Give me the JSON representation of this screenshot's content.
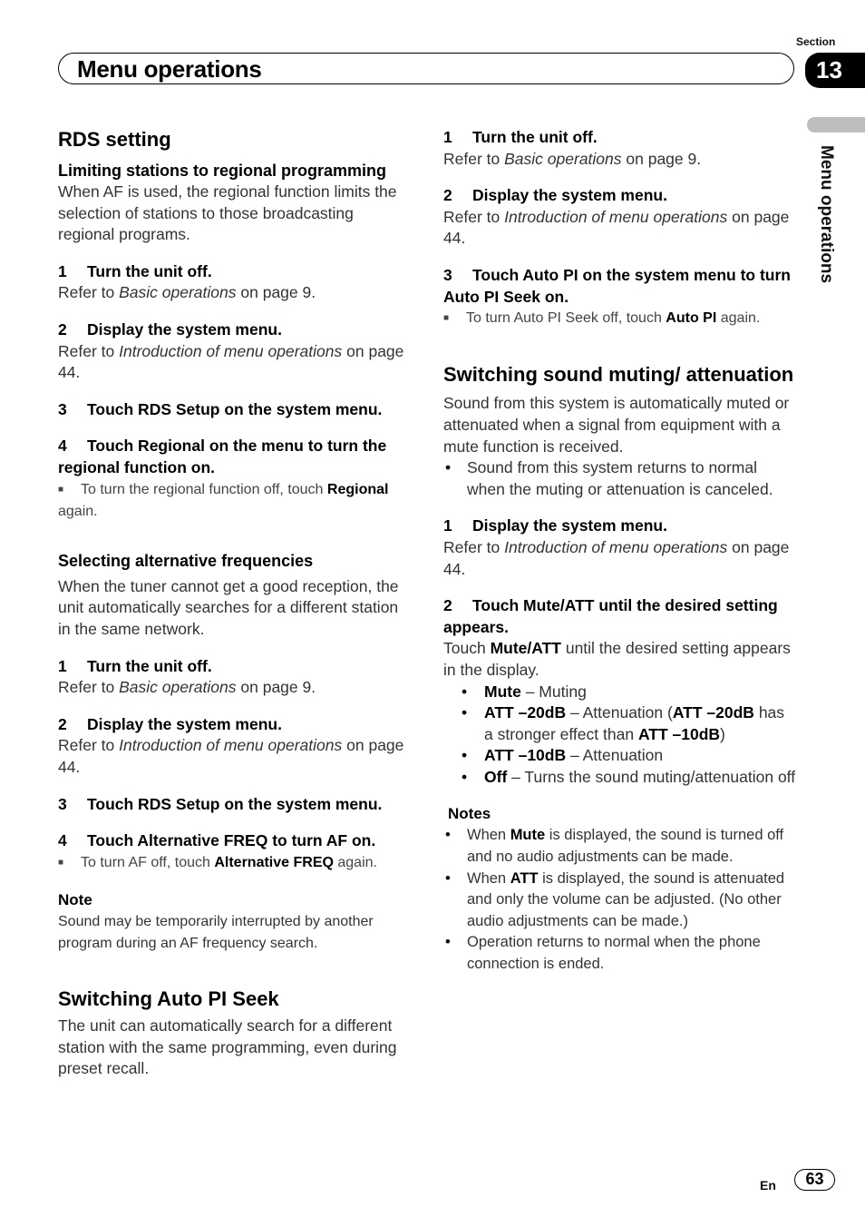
{
  "header": {
    "title": "Menu operations",
    "section_label": "Section",
    "section_number": "13",
    "side_tab_text": "Menu operations"
  },
  "left": {
    "rds_heading": "RDS setting",
    "regional": {
      "heading": "Limiting stations to regional programming",
      "intro": "When AF is used, the regional function limits the selection of stations to those broadcasting regional programs.",
      "steps": [
        {
          "num": "1",
          "title": "Turn the unit off.",
          "ref_pre": "Refer to ",
          "ref_em": "Basic operations",
          "ref_post": " on page 9."
        },
        {
          "num": "2",
          "title": "Display the system menu.",
          "ref_pre": "Refer to ",
          "ref_em": "Introduction of menu operations",
          "ref_post": " on page 44."
        },
        {
          "num": "3",
          "title": "Touch RDS Setup on the system menu."
        },
        {
          "num": "4",
          "title": "Touch Regional on the menu to turn the regional function on."
        }
      ],
      "tip_pre": "To turn the regional function off, touch ",
      "tip_bold": "Regional",
      "tip_post": " again."
    },
    "af": {
      "heading": "Selecting alternative frequencies",
      "intro": "When the tuner cannot get a good reception, the unit automatically searches for a different station in the same network.",
      "steps": [
        {
          "num": "1",
          "title": "Turn the unit off.",
          "ref_pre": "Refer to ",
          "ref_em": "Basic operations",
          "ref_post": " on page 9."
        },
        {
          "num": "2",
          "title": "Display the system menu.",
          "ref_pre": "Refer to ",
          "ref_em": "Introduction of menu operations",
          "ref_post": " on page 44."
        },
        {
          "num": "3",
          "title": "Touch RDS Setup on the system menu."
        },
        {
          "num": "4",
          "title": "Touch Alternative FREQ to turn AF on."
        }
      ],
      "tip_pre": "To turn AF off, touch ",
      "tip_bold": "Alternative FREQ",
      "tip_post": " again.",
      "note_heading": "Note",
      "note_text": "Sound may be temporarily interrupted by another program during an AF frequency search."
    },
    "autopi": {
      "heading": "Switching Auto PI Seek",
      "intro": "The unit can automatically search for a different station with the same programming, even during preset recall."
    }
  },
  "right": {
    "autopi_steps": [
      {
        "num": "1",
        "title": "Turn the unit off.",
        "ref_pre": "Refer to ",
        "ref_em": "Basic operations",
        "ref_post": " on page 9."
      },
      {
        "num": "2",
        "title": "Display the system menu.",
        "ref_pre": "Refer to ",
        "ref_em": "Introduction of menu operations",
        "ref_post": " on page 44."
      },
      {
        "num": "3",
        "title": "Touch Auto PI on the system menu to turn Auto PI Seek on."
      }
    ],
    "autopi_tip_pre": "To turn Auto PI Seek off, touch ",
    "autopi_tip_bold": "Auto PI",
    "autopi_tip_post": " again.",
    "mute": {
      "heading": "Switching sound muting/ attenuation",
      "intro": "Sound from this system is automatically muted or attenuated when a signal from equipment with a mute function is received.",
      "bullet": "Sound from this system returns to normal when the muting or attenuation is canceled.",
      "steps": [
        {
          "num": "1",
          "title": "Display the system menu.",
          "ref_pre": "Refer to ",
          "ref_em": "Introduction of menu operations",
          "ref_post": " on page 44."
        },
        {
          "num": "2",
          "title": "Touch Mute/ATT until the desired setting appears."
        }
      ],
      "step2_pre": "Touch ",
      "step2_bold": "Mute/ATT",
      "step2_post": " until the desired setting appears in the display.",
      "options": [
        {
          "bold": "Mute",
          "text": " – Muting"
        },
        {
          "bold": "ATT –20dB",
          "text": " – Attenuation (",
          "bold2": "ATT –20dB",
          "text2": " has a stronger effect than ",
          "bold3": "ATT –10dB",
          "text3": ")"
        },
        {
          "bold": "ATT –10dB",
          "text": " – Attenuation"
        },
        {
          "bold": "Off",
          "text": " – Turns the sound muting/attenuation off"
        }
      ],
      "notes_heading": "Notes",
      "notes": [
        {
          "pre": "When ",
          "bold": "Mute",
          "post": " is displayed, the sound is turned off and no audio adjustments can be made."
        },
        {
          "pre": "When ",
          "bold": "ATT",
          "post": " is displayed, the sound is attenuated and only the volume can be adjusted. (No other audio adjustments can be made.)"
        },
        {
          "pre": "Operation returns to normal when the phone connection is ended.",
          "bold": "",
          "post": ""
        }
      ]
    }
  },
  "footer": {
    "lang": "En",
    "page": "63"
  }
}
